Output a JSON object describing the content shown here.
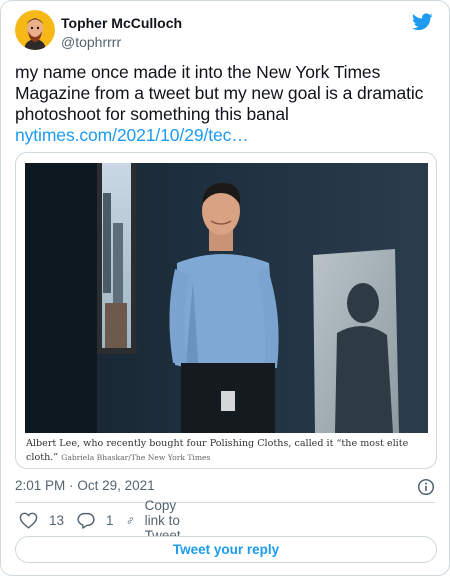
{
  "author": {
    "name": "Topher McCulloch",
    "handle": "@tophrrrr"
  },
  "tweet": {
    "text": "my name once made it into the New York Times Magazine from a tweet but my new goal is a dramatic photoshoot for something this banal",
    "link_text": "nytimes.com/2021/10/29/tec…"
  },
  "media": {
    "caption": "Albert Lee, who recently bought four Polishing Cloths, called it “the most elite cloth.”",
    "credit": "Gabriela Bhaskar/The New York Times"
  },
  "meta": {
    "time": "2:01 PM",
    "separator": "·",
    "date": "Oct 29, 2021"
  },
  "actions": {
    "like_count": "13",
    "reply_count": "1",
    "copy_link_label": "Copy link to Tweet"
  },
  "reply_button_label": "Tweet your reply",
  "colors": {
    "accent": "#1d9bf0",
    "text": "#0f1419",
    "secondary": "#536471",
    "border": "#cfd9de",
    "avatar_bg": "#f5b817"
  },
  "icons": [
    "twitter-bird-icon",
    "info-icon",
    "heart-icon",
    "reply-bubble-icon",
    "link-icon"
  ]
}
